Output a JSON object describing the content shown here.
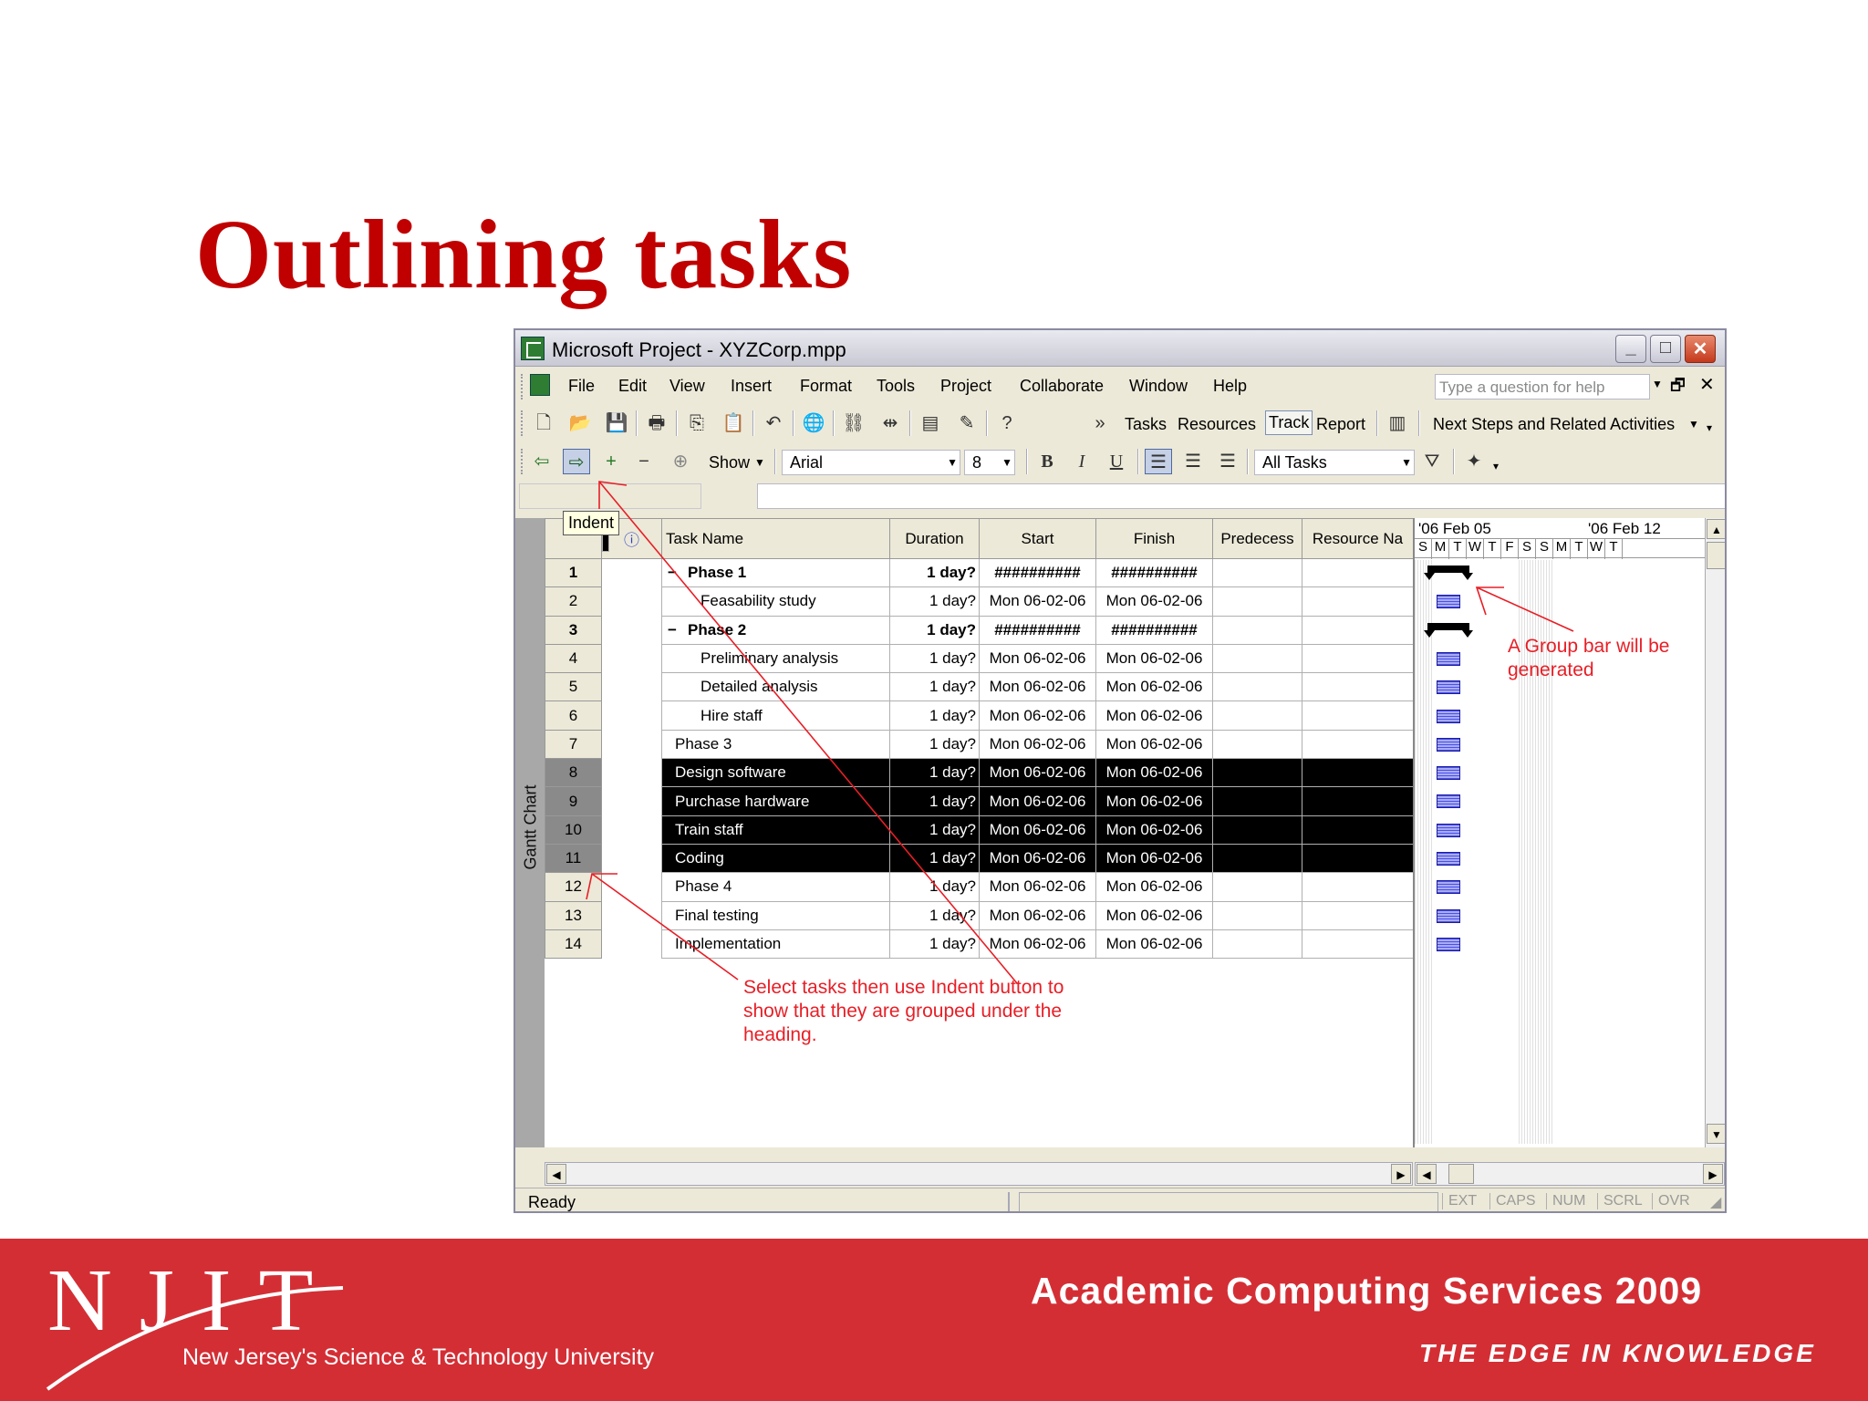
{
  "slide": {
    "title": "Outlining tasks"
  },
  "window": {
    "title": "Microsoft Project - XYZCorp.mpp",
    "menus": [
      "File",
      "Edit",
      "View",
      "Insert",
      "Format",
      "Tools",
      "Project",
      "Collaborate",
      "Window",
      "Help"
    ],
    "help_placeholder": "Type a question for help"
  },
  "toolbar1": {
    "guide_tasks": "Tasks",
    "guide_resources": "Resources",
    "guide_track": "Track",
    "guide_report": "Report",
    "next_steps": "Next Steps and Related Activities"
  },
  "toolbar2": {
    "show_label": "Show",
    "font_name": "Arial",
    "font_size": "8",
    "bold": "B",
    "italic": "I",
    "underline": "U",
    "filter": "All Tasks"
  },
  "tooltip": "Indent",
  "view_bar_label": "Gantt Chart",
  "columns": {
    "task_name": "Task Name",
    "duration": "Duration",
    "start": "Start",
    "finish": "Finish",
    "predecessors": "Predecess",
    "resource": "Resource Na"
  },
  "tasks": [
    {
      "id": "1",
      "name": "Phase 1",
      "duration": "1 day?",
      "start": "##########",
      "finish": "##########",
      "summary": true,
      "selected": false
    },
    {
      "id": "2",
      "name": "Feasability study",
      "duration": "1 day?",
      "start": "Mon 06-02-06",
      "finish": "Mon 06-02-06",
      "summary": false,
      "selected": false
    },
    {
      "id": "3",
      "name": "Phase 2",
      "duration": "1 day?",
      "start": "##########",
      "finish": "##########",
      "summary": true,
      "selected": false
    },
    {
      "id": "4",
      "name": "Preliminary analysis",
      "duration": "1 day?",
      "start": "Mon 06-02-06",
      "finish": "Mon 06-02-06",
      "summary": false,
      "selected": false
    },
    {
      "id": "5",
      "name": "Detailed analysis",
      "duration": "1 day?",
      "start": "Mon 06-02-06",
      "finish": "Mon 06-02-06",
      "summary": false,
      "selected": false
    },
    {
      "id": "6",
      "name": "Hire staff",
      "duration": "1 day?",
      "start": "Mon 06-02-06",
      "finish": "Mon 06-02-06",
      "summary": false,
      "selected": false
    },
    {
      "id": "7",
      "name": "Phase 3",
      "duration": "1 day?",
      "start": "Mon 06-02-06",
      "finish": "Mon 06-02-06",
      "summary": false,
      "selected": false
    },
    {
      "id": "8",
      "name": "Design software",
      "duration": "1 day?",
      "start": "Mon 06-02-06",
      "finish": "Mon 06-02-06",
      "summary": false,
      "selected": true
    },
    {
      "id": "9",
      "name": "Purchase hardware",
      "duration": "1 day?",
      "start": "Mon 06-02-06",
      "finish": "Mon 06-02-06",
      "summary": false,
      "selected": true
    },
    {
      "id": "10",
      "name": "Train staff",
      "duration": "1 day?",
      "start": "Mon 06-02-06",
      "finish": "Mon 06-02-06",
      "summary": false,
      "selected": true
    },
    {
      "id": "11",
      "name": "Coding",
      "duration": "1 day?",
      "start": "Mon 06-02-06",
      "finish": "Mon 06-02-06",
      "summary": false,
      "selected": true
    },
    {
      "id": "12",
      "name": "Phase 4",
      "duration": "1 day?",
      "start": "Mon 06-02-06",
      "finish": "Mon 06-02-06",
      "summary": false,
      "selected": false
    },
    {
      "id": "13",
      "name": "Final testing",
      "duration": "1 day?",
      "start": "Mon 06-02-06",
      "finish": "Mon 06-02-06",
      "summary": false,
      "selected": false
    },
    {
      "id": "14",
      "name": "Implementation",
      "duration": "1 day?",
      "start": "Mon 06-02-06",
      "finish": "Mon 06-02-06",
      "summary": false,
      "selected": false
    }
  ],
  "gantt": {
    "week1": "'06 Feb 05",
    "week2": "'06 Feb 12",
    "days": [
      "S",
      "M",
      "T",
      "W",
      "T",
      "F",
      "S",
      "S",
      "M",
      "T",
      "W",
      "T"
    ]
  },
  "status": {
    "ready": "Ready",
    "indicators": [
      "EXT",
      "CAPS",
      "NUM",
      "SCRL",
      "OVR"
    ]
  },
  "annotations": {
    "group_bar": "A Group bar will be generated",
    "indent_help": "Select tasks then use Indent button to show that they are grouped under the heading."
  },
  "footer": {
    "logo_letters": "NJIT",
    "logo_tagline": "New Jersey's Science & Technology University",
    "title": "Academic Computing Services 2009",
    "tagline": "THE EDGE IN KNOWLEDGE"
  },
  "colors": {
    "title_red": "#c00000",
    "footer_red": "#d42e35",
    "annotation_red": "#e81e26",
    "bar_blue": "#4a50e8"
  }
}
